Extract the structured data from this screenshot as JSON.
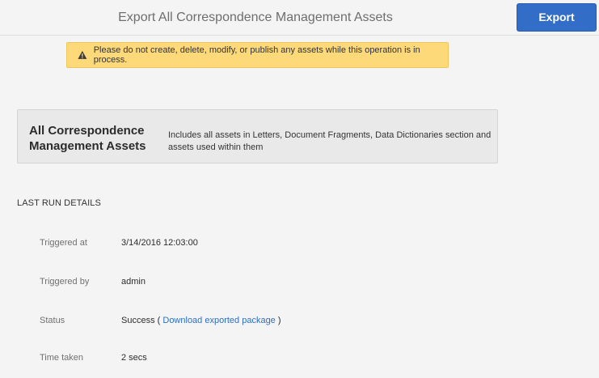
{
  "header": {
    "title": "Export All Correspondence Management Assets",
    "export_label": "Export"
  },
  "warning": {
    "icon": "warning-triangle-icon",
    "text": "Please do not create, delete, modify, or publish any assets while this operation is in process."
  },
  "card": {
    "title_line1": "All Correspondence",
    "title_line2": "Management Assets",
    "description_line1": "Includes all assets in Letters, Document Fragments, Data Dictionaries section and",
    "description_line2": "assets used within them"
  },
  "last_run": {
    "heading": "LAST RUN DETAILS",
    "triggered_at": {
      "label": "Triggered at",
      "value": "3/14/2016 12:03:00"
    },
    "triggered_by": {
      "label": "Triggered by",
      "value": "admin"
    },
    "status": {
      "label": "Status",
      "value": "Success",
      "open_paren": "(",
      "link_text": "Download exported package",
      "close_paren": ")"
    },
    "time_taken": {
      "label": "Time taken",
      "value": "2 secs"
    }
  },
  "colors": {
    "accent": "#326ec8",
    "warning_bg": "#fdd97a",
    "link": "#2d6fc1"
  }
}
